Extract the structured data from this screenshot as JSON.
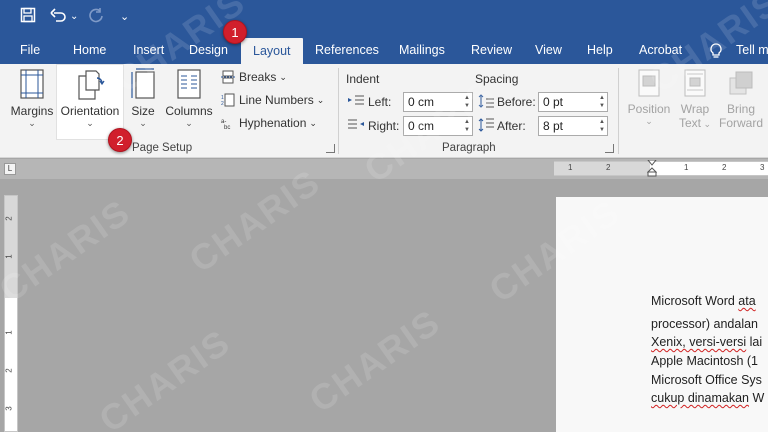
{
  "quick_access": {
    "icons": [
      "save-icon",
      "undo-icon",
      "undo-dropdown-icon",
      "redo-icon",
      "customize-qat-icon"
    ]
  },
  "tabs": [
    {
      "label": "File",
      "active": false
    },
    {
      "label": "Home",
      "active": false
    },
    {
      "label": "Insert",
      "active": false
    },
    {
      "label": "Design",
      "active": false
    },
    {
      "label": "Layout",
      "active": true
    },
    {
      "label": "References",
      "active": false
    },
    {
      "label": "Mailings",
      "active": false
    },
    {
      "label": "Review",
      "active": false
    },
    {
      "label": "View",
      "active": false
    },
    {
      "label": "Help",
      "active": false
    },
    {
      "label": "Acrobat",
      "active": false
    }
  ],
  "tell_me": {
    "text": "Tell m",
    "icon": "lightbulb-icon"
  },
  "page_setup": {
    "group_label": "Page Setup",
    "margins": "Margins",
    "orientation": "Orientation",
    "size": "Size",
    "columns": "Columns",
    "breaks": "Breaks",
    "line_numbers": "Line Numbers",
    "hyphenation": "Hyphenation"
  },
  "paragraph": {
    "group_label": "Paragraph",
    "indent_label": "Indent",
    "left_label": "Left:",
    "left_value": "0 cm",
    "right_label": "Right:",
    "right_value": "0 cm",
    "spacing_label": "Spacing",
    "before_label": "Before:",
    "before_value": "0 pt",
    "after_label": "After:",
    "after_value": "8 pt"
  },
  "arrange": {
    "position": "Position",
    "wrap_text_1": "Wrap",
    "wrap_text_2": "Text",
    "bring_forward_1": "Bring",
    "bring_forward_2": "Forward"
  },
  "ruler": {
    "h_numbers": [
      "1",
      "2",
      "1",
      "2",
      "3"
    ],
    "v_numbers": [
      "2",
      "1",
      "1",
      "2",
      "3"
    ]
  },
  "markers": [
    "1",
    "2"
  ],
  "document": {
    "lines": [
      {
        "plain": "Microsoft Word ",
        "squiggle": "ata"
      },
      {
        "plain": "processor) andalan ",
        "squiggle": ""
      },
      {
        "plain": "",
        "squiggle": "Xenix, versi-versi",
        "tail": " lai"
      },
      {
        "plain": "Apple Macintosh (1",
        "squiggle": ""
      },
      {
        "plain": "Microsoft Office Sys",
        "squiggle": ""
      },
      {
        "plain": "",
        "squiggle": "cukup dinamakan",
        "tail": " W"
      }
    ]
  },
  "watermark": "CHARIS",
  "colors": {
    "title_bar": "#2b579a",
    "ribbon": "#f3f3f3",
    "marker": "#d11f2c",
    "workspace": "#a6a6a6"
  }
}
